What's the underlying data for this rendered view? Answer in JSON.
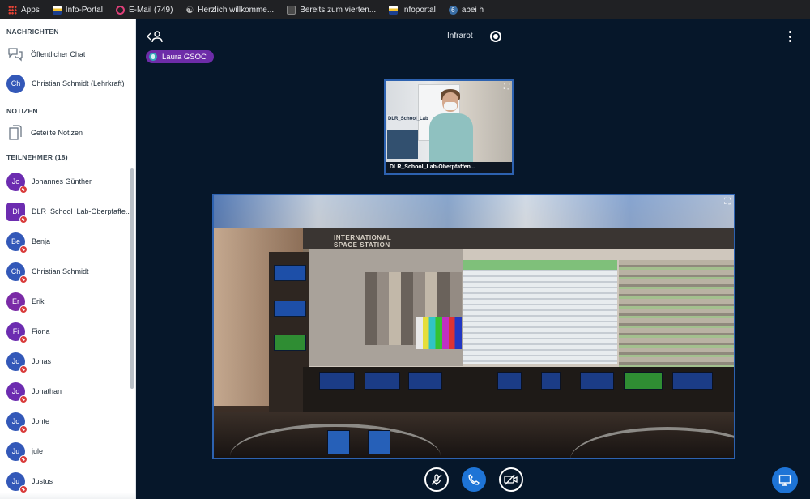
{
  "bookmarks": [
    {
      "label": "Apps",
      "icon": "apps-grid-icon"
    },
    {
      "label": "Info-Portal",
      "icon": "flag-icon"
    },
    {
      "label": "E-Mail (749)",
      "icon": "mail-icon"
    },
    {
      "label": "Herzlich willkomme...",
      "icon": "wave-icon"
    },
    {
      "label": "Bereits zum vierten...",
      "icon": "page-icon"
    },
    {
      "label": "Infoportal",
      "icon": "flag-icon"
    },
    {
      "label": "abei h",
      "icon": "six-icon"
    }
  ],
  "sidebar": {
    "messages_title": "NACHRICHTEN",
    "public_chat": "Öffentlicher Chat",
    "private_chat": {
      "initials": "Ch",
      "label": "Christian Schmidt (Lehrkraft)"
    },
    "notes_title": "NOTIZEN",
    "shared_notes": "Geteilte Notizen",
    "participants_title": "TEILNEHMER (18)",
    "participants": [
      {
        "initials": "Jo",
        "name": "Johannes Günther",
        "color": "#6c2cb0"
      },
      {
        "initials": "Dl",
        "name": "DLR_School_Lab-Oberpfaffe...",
        "color": "#6c2cb0"
      },
      {
        "initials": "Be",
        "name": "Benja",
        "color": "#3358b8"
      },
      {
        "initials": "Ch",
        "name": "Christian Schmidt",
        "color": "#3358b8"
      },
      {
        "initials": "Er",
        "name": "Erik",
        "color": "#7a2aa6"
      },
      {
        "initials": "Fi",
        "name": "Fiona",
        "color": "#6c2cb0"
      },
      {
        "initials": "Jo",
        "name": "Jonas",
        "color": "#3358b8"
      },
      {
        "initials": "Jo",
        "name": "Jonathan",
        "color": "#6c2cb0"
      },
      {
        "initials": "Jo",
        "name": "Jonte",
        "color": "#3358b8"
      },
      {
        "initials": "Ju",
        "name": "jule",
        "color": "#3358b8"
      },
      {
        "initials": "Ju",
        "name": "Justus",
        "color": "#3358b8"
      }
    ]
  },
  "main": {
    "title": "Infrarot",
    "talking_user": "Laura GSOC",
    "webcam_caption": "DLR_School_Lab-Oberpfaffen...",
    "webcam_poster_text": "DLR_School_Lab",
    "screen_text": "INTERNATIONAL SPACE STATION"
  },
  "colors": {
    "accent": "#1e74d6",
    "talker": "#6d2ca8",
    "background": "#06172a"
  }
}
